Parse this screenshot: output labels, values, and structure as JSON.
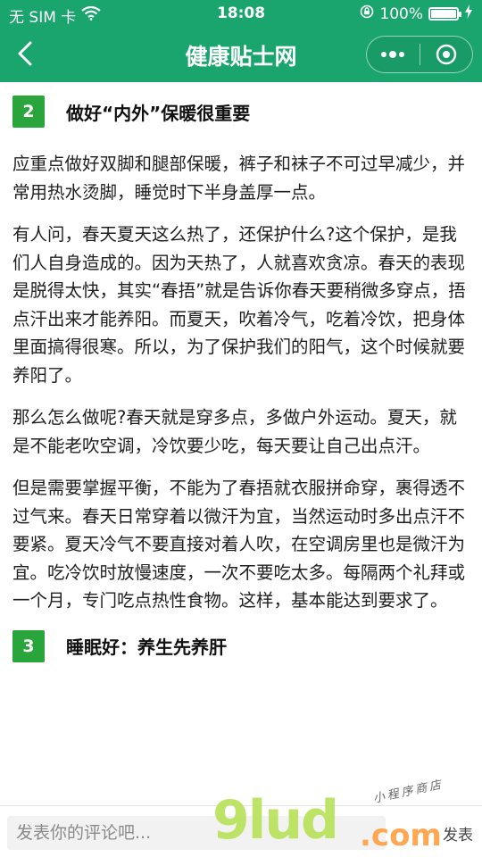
{
  "status_bar": {
    "carrier": "无 SIM 卡",
    "time": "18:08",
    "battery_percent_text": "100%",
    "battery_level": 1.0
  },
  "nav": {
    "title": "健康贴士网"
  },
  "article": {
    "section2": {
      "number": "2",
      "title": "做好“内外”保暖很重要"
    },
    "paragraphs": [
      "应重点做好双脚和腿部保暖，裤子和袜子不可过早减少，并常用热水烫脚，睡觉时下半身盖厚一点。",
      "有人问，春天夏天这么热了，还保护什么?这个保护，是我们人自身造成的。因为天热了，人就喜欢贪凉。春天的表现是脱得太快，其实“春捂”就是告诉你春天要稍微多穿点，捂点汗出来才能养阳。而夏天，吹着冷气，吃着冷饮，把身体里面搞得很寒。所以，为了保护我们的阳气，这个时候就要养阳了。",
      "那么怎么做呢?春天就是穿多点，多做户外运动。夏天，就是不能老吹空调，冷饮要少吃，每天要让自己出点汗。",
      "但是需要掌握平衡，不能为了春捂就衣服拼命穿，裹得透不过气来。春天日常穿着以微汗为宜，当然运动时多出点汗不要紧。夏天冷气不要直接对着人吹，在空调房里也是微汗为宜。吃冷饮时放慢速度，一次不要吃太多。每隔两个礼拜或一个月，专门吃点热性食物。这样，基本能达到要求了。"
    ],
    "section3": {
      "number": "3",
      "title": "睡眠好：养生先养肝"
    }
  },
  "comment_bar": {
    "placeholder": "发表你的评论吧...",
    "send_label": "发表"
  },
  "watermark": {
    "main": "9lud",
    "suffix": ".com",
    "subtitle": "小程序商店"
  },
  "colors": {
    "header_bg": "#1aa56e",
    "badge_bg": "#2aa53c"
  }
}
